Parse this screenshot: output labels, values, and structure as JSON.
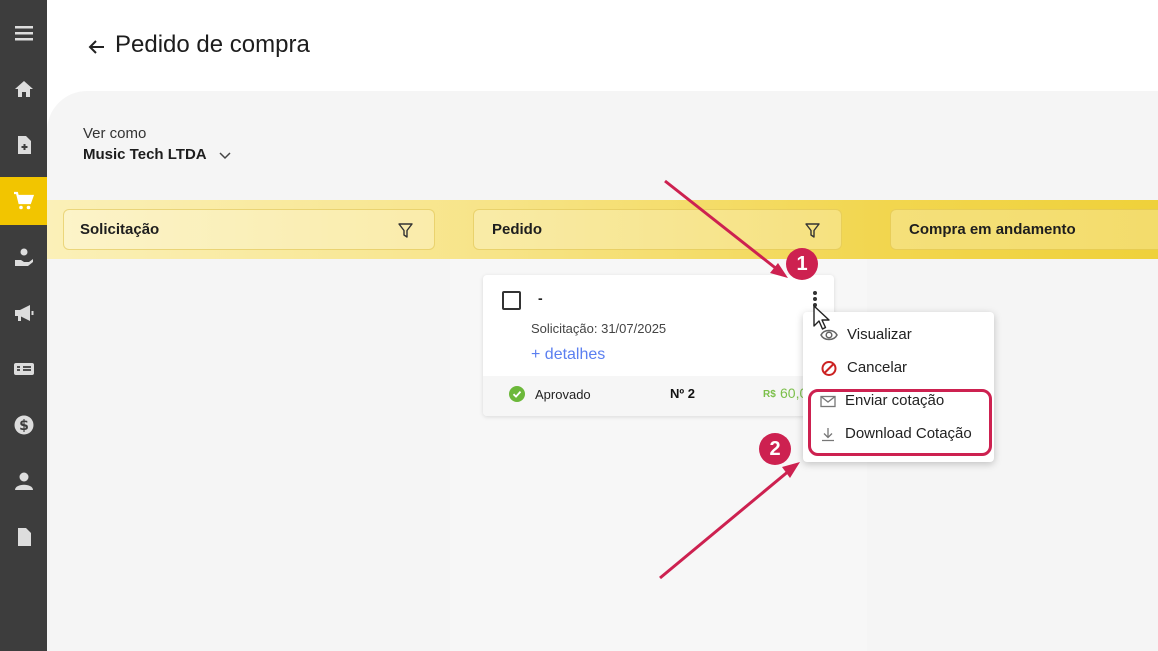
{
  "header": {
    "title": "Pedido de compra"
  },
  "selector": {
    "label": "Ver como",
    "company": "Music Tech LTDA"
  },
  "columns": [
    {
      "label": "Solicitação"
    },
    {
      "label": "Pedido"
    },
    {
      "label": "Compra em andamento"
    }
  ],
  "card": {
    "title": "-",
    "request_date": "Solicitação: 31/07/2025",
    "details_link": "+ detalhes",
    "status": "Aprovado",
    "number": "Nº 2",
    "currency": "R$",
    "amount": "60,00"
  },
  "menu": {
    "items": [
      {
        "label": "Visualizar",
        "icon": "eye-icon"
      },
      {
        "label": "Cancelar",
        "icon": "cancel-icon"
      },
      {
        "label": "Enviar cotação",
        "icon": "mail-icon"
      },
      {
        "label": "Download Cotação",
        "icon": "download-icon"
      }
    ]
  },
  "annotations": {
    "step1": "1",
    "step2": "2"
  },
  "colors": {
    "accent": "#f2c500",
    "sidebar": "#3d3d3d",
    "annotation": "#cd2150",
    "link": "#5b7ff0",
    "success": "#7bbf4a"
  }
}
